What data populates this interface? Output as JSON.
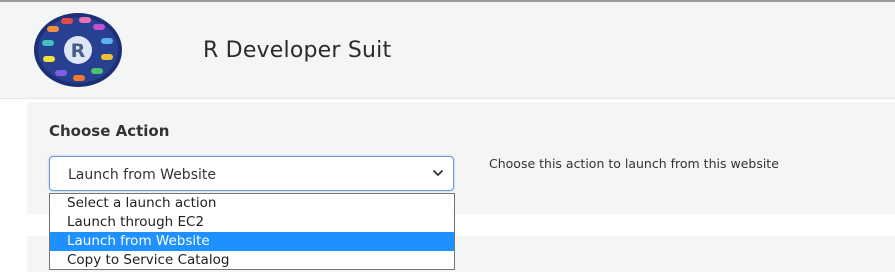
{
  "app": {
    "title": "R Developer Suit",
    "logo_letter": "R"
  },
  "action_section": {
    "heading": "Choose Action",
    "selected_value": "Launch from Website",
    "help_text": "Choose this action to launch from this website",
    "options": [
      "Select a launch action",
      "Launch through EC2",
      "Launch from Website",
      "Copy to Service Catalog"
    ],
    "highlighted_option": "Launch from Website"
  },
  "colors": {
    "header_bg": "#f4f5f5",
    "select_border": "#6b9ad9",
    "highlight": "#1e90ff",
    "logo_ring": "#1c2f77"
  },
  "icons": {
    "logo": "r-developer-suite-logo",
    "chevron": "chevron-down-icon"
  }
}
